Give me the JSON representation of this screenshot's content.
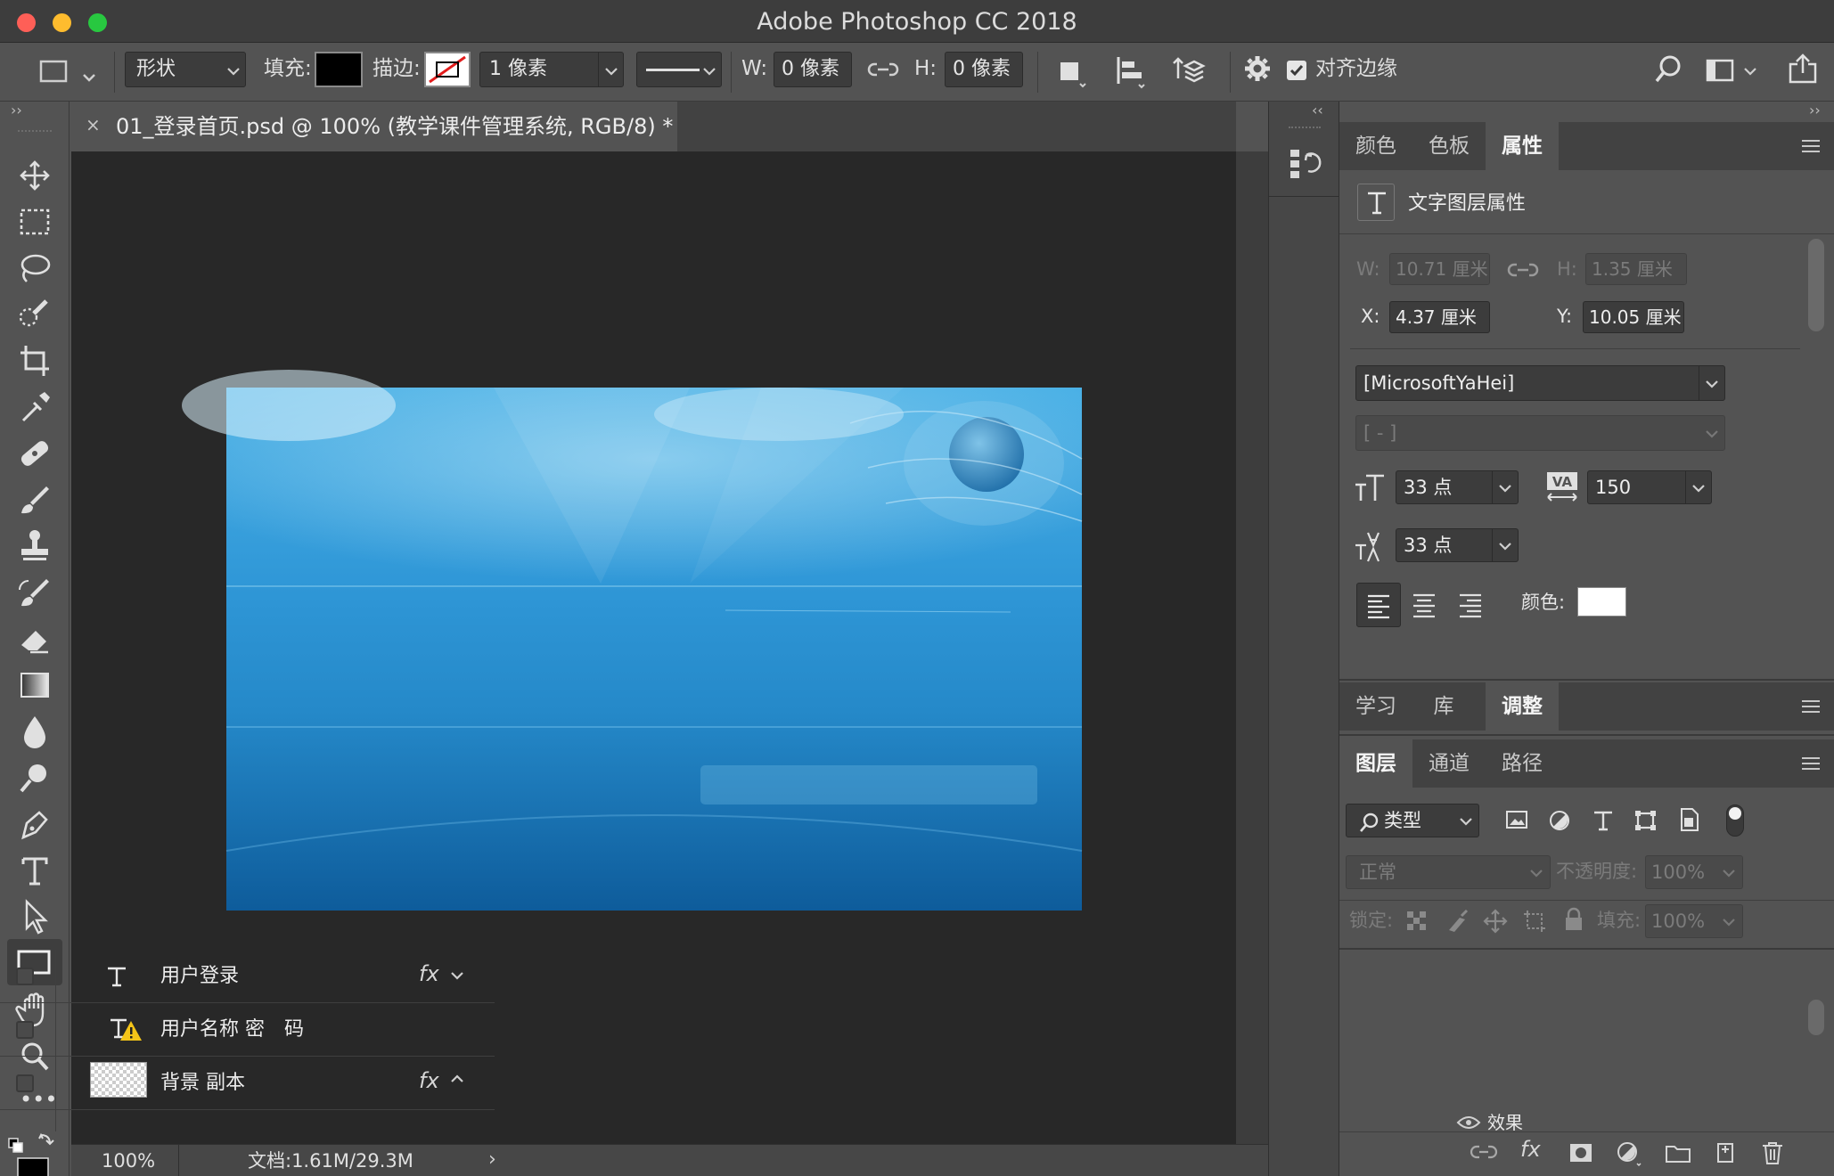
{
  "app": {
    "title": "Adobe Photoshop CC 2018"
  },
  "options": {
    "mode": "形状",
    "fill_label": "填充:",
    "stroke_label": "描边:",
    "stroke_width": "1 像素",
    "w_label": "W:",
    "w_value": "0 像素",
    "h_label": "H:",
    "h_value": "0 像素",
    "align_edges": "对齐边缘",
    "fill_color": "#000000"
  },
  "document": {
    "tab_title": "01_登录首页.psd @ 100% (教学课件管理系统, RGB/8) *",
    "zoom": "100%",
    "doc_info": "文档:1.61M/29.3M"
  },
  "properties_panel": {
    "tabs": [
      "颜色",
      "色板",
      "属性"
    ],
    "active_tab": "属性",
    "header": "文字图层属性",
    "w_label": "W:",
    "w_value": "10.71 厘米",
    "h_label": "H:",
    "h_value": "1.35 厘米",
    "x_label": "X:",
    "x_value": "4.37 厘米",
    "y_label": "Y:",
    "y_value": "10.05 厘米",
    "font_family": "[MicrosoftYaHei]",
    "font_style": "[ - ]",
    "font_size": "33 点",
    "tracking": "150",
    "leading": "33 点",
    "color_label": "颜色:",
    "text_color": "#ffffff"
  },
  "lower_tabs": {
    "items": [
      "学习",
      "库",
      "调整"
    ],
    "active": "调整"
  },
  "layers_panel": {
    "tabs": [
      "图层",
      "通道",
      "路径"
    ],
    "active_tab": "图层",
    "filter": "类型",
    "blend_mode": "正常",
    "opacity_label": "不透明度:",
    "opacity": "100%",
    "lock_label": "锁定:",
    "fill_label": "填充:",
    "fill": "100%",
    "layers": [
      {
        "name": "用户登录",
        "kind": "text",
        "fx": "fx"
      },
      {
        "name": "用户名称 密　码",
        "kind": "text-warning",
        "fx": ""
      },
      {
        "name": "背景 副本",
        "kind": "image",
        "fx": "fx"
      }
    ],
    "effects_label": "效果"
  },
  "colors": {
    "accent": "#1b76b8",
    "panel_bg": "#535353",
    "canvas_bg": "#282828"
  }
}
